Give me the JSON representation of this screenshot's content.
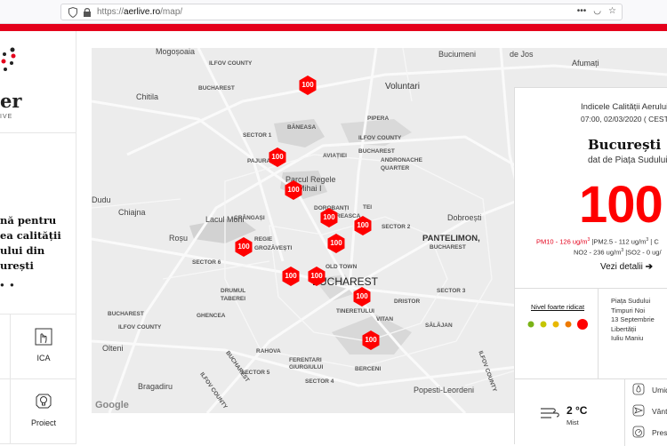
{
  "browser": {
    "url_scheme": "https://",
    "url_host": "aerlive.ro",
    "url_path": "/map/"
  },
  "brand": {
    "logo_text": "er",
    "logo_sub": "IVE",
    "accent": "#e4001b"
  },
  "tagline": {
    "line1": "nă pentru",
    "line2": "ea calității",
    "line3": "ului din",
    "line4": "urești"
  },
  "nav": {
    "ica_label": "ICA",
    "proiect_label": "Proiect"
  },
  "map": {
    "google_label": "Google",
    "labels": {
      "mogosoaia": "Mogoșoaia",
      "ilfov_county_1": "ILFOV COUNTY",
      "bucharest_1": "BUCHAREST",
      "chitila": "Chitila",
      "voluntari": "Voluntari",
      "afumati": "Afumați",
      "jos": "de Jos",
      "baneasa": "BĂNEASA",
      "pipera": "PIPERA",
      "ilfov_county_2": "ILFOV COUNTY",
      "bucharest_2": "BUCHAREST",
      "sector1": "SECTOR 1",
      "aviatiei": "AVIAȚIEI",
      "pajura": "PAJURA",
      "andronache": "ANDRONACHE",
      "quarter": "QUARTER",
      "buciumeni": "Buciumeni",
      "parcul": "Parcul Regele",
      "mihai": "Mihai I",
      "tei": "TEI",
      "dorobanti": "DOROBANȚI",
      "floreasca": "FLOREASCA",
      "dobroesti": "Dobroești",
      "dudu": "Dudu",
      "chiajna": "Chiajna",
      "lacul": "Lacul Morii",
      "crangasi": "CRÂNGAȘI",
      "sector2": "SECTOR 2",
      "pantelimon": "PANTELIMON,",
      "bucharest_3": "BUCHAREST",
      "rosu": "Roșu",
      "regie": "REGIE",
      "grozavesti": "GROZĂVEȘTI",
      "sector6": "SECTOR 6",
      "old_town": "OLD TOWN",
      "bucharest_city": "Bucharest",
      "sector3": "SECTOR 3",
      "drumul": "DRUMUL",
      "taberei": "TABEREI",
      "dristor": "DRISTOR",
      "tineretului": "TINERETULUI",
      "bucharest_4": "BUCHAREST",
      "ghencea": "GHENCEA",
      "vitan": "VITAN",
      "ilfov_county_3": "ILFOV COUNTY",
      "salajan": "SĂLĂJAN",
      "olteni": "Olteni",
      "rahova": "RAHOVA",
      "ferentari": "FERENTARI",
      "giurgiului": "GIURGIULUI",
      "ilfov_county_4": "ILFOV COUNTY",
      "bucharest_5": "BUCHAREST",
      "sector5": "SECTOR 5",
      "berceni": "BERCENI",
      "sector4": "SECTOR 4",
      "bragadiru": "Bragadiru",
      "popesti": "Popesti-Leordeni",
      "ilfov_county_5": "ILFOV COUNTY"
    },
    "marker_value": "100"
  },
  "info": {
    "title": "Indicele Calității Aerului",
    "datetime": "07:00, 02/03/2020 ( CEST",
    "city": "București",
    "station_prefix": "dat de Piața Sudului",
    "aqi_value": "100",
    "pm10": "PM10 - 126 ug/m",
    "pm25": "|PM2.5 - 112 ug/m",
    "co": "| C",
    "no2": "NO2 - 236 ug/m",
    "so2": "|SO2 - 0 ug/",
    "details_label": "Vezi detalii",
    "level_label": "Nivel foarte ridicat",
    "level_colors": [
      "#7ab317",
      "#c5c500",
      "#e8b800",
      "#ee7a00",
      "#ff0000"
    ],
    "stations": [
      "Piața Sudului",
      "Timpuri Noi",
      "13 Septembrie",
      "Libertății",
      "Iuliu Maniu"
    ],
    "temperature": "2 °C",
    "condition": "Mist",
    "humidity_label": "Umid",
    "wind_label": "Vânt",
    "pressure_label": "Presi"
  }
}
